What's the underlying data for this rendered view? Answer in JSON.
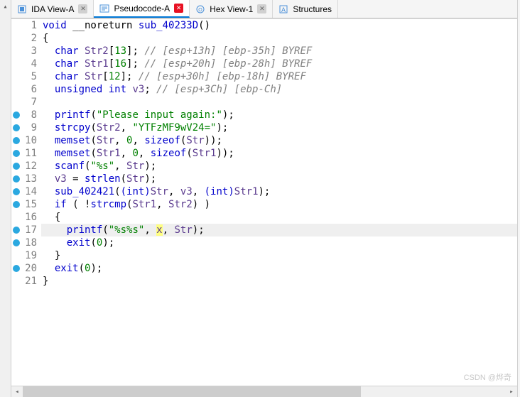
{
  "tabs": [
    {
      "icon": "ida-view-icon",
      "label": "IDA View-A",
      "close": "gray",
      "active": false
    },
    {
      "icon": "pseudocode-icon",
      "label": "Pseudocode-A",
      "close": "red",
      "active": true
    },
    {
      "icon": "hex-view-icon",
      "label": "Hex View-1",
      "close": "gray",
      "active": false
    },
    {
      "icon": "structures-icon",
      "label": "Structures",
      "close": "",
      "active": false
    }
  ],
  "code": {
    "fn_sig_void": "void",
    "fn_sig_noreturn": " __noreturn ",
    "fn_name": "sub_40233D",
    "fn_sig_tail": "()",
    "brace_open": "{",
    "brace_close": "}",
    "line3_a": "  char",
    "line3_b": " Str2",
    "line3_c": "[",
    "line3_d": "13",
    "line3_e": "]; ",
    "line3_f": "// [esp+13h] [ebp-35h] BYREF",
    "line4_a": "  char",
    "line4_b": " Str1",
    "line4_c": "[",
    "line4_d": "16",
    "line4_e": "]; ",
    "line4_f": "// [esp+20h] [ebp-28h] BYREF",
    "line5_a": "  char",
    "line5_b": " Str",
    "line5_c": "[",
    "line5_d": "12",
    "line5_e": "]; ",
    "line5_f": "// [esp+30h] [ebp-18h] BYREF",
    "line6_a": "  unsigned",
    "line6_a2": " int",
    "line6_b": " v3",
    "line6_c": "; ",
    "line6_f": "// [esp+3Ch] [ebp-Ch]",
    "line8_a": "  ",
    "line8_fn": "printf",
    "line8_b": "(",
    "line8_s": "\"Please input again:\"",
    "line8_c": ");",
    "line9_fn": "strcpy",
    "line9_a": "(",
    "line9_v": "Str2",
    "line9_b": ", ",
    "line9_s": "\"YTFzMF9wV24=\"",
    "line9_c": ");",
    "line10_fn": "memset",
    "line10_v": "Str",
    "line10_z": "0",
    "line10_sz": "sizeof",
    "line11_v": "Str1",
    "line12_fn": "scanf",
    "line12_s": "\"%s\"",
    "line13_v3": "v3",
    "line13_eq": " = ",
    "line13_fn": "strlen",
    "line14_fn": "sub_402421",
    "line14_cast": "(int)",
    "line14_str": "Str",
    "line14_v3": "v3",
    "line14_str1": "Str1",
    "line15_if": "if",
    "line15_not": " ( !",
    "line15_fn": "strcmp",
    "line15_a": "Str1",
    "line15_b": "Str2",
    "line15_c": ") )",
    "line17_fn": "printf",
    "line17_s": "\"%s%s\"",
    "line17_x": "x",
    "line17_str": "Str",
    "line18_fn": "exit",
    "line18_z": "0",
    "line20_fn": "exit"
  },
  "watermark": "CSDN @烨奇",
  "linenumbers": [
    "1",
    "2",
    "3",
    "4",
    "5",
    "6",
    "7",
    "8",
    "9",
    "10",
    "11",
    "12",
    "13",
    "14",
    "15",
    "16",
    "17",
    "18",
    "19",
    "20",
    "21"
  ],
  "breakpoints": [
    false,
    false,
    false,
    false,
    false,
    false,
    false,
    true,
    true,
    true,
    true,
    true,
    true,
    true,
    true,
    false,
    true,
    true,
    false,
    true,
    false
  ]
}
